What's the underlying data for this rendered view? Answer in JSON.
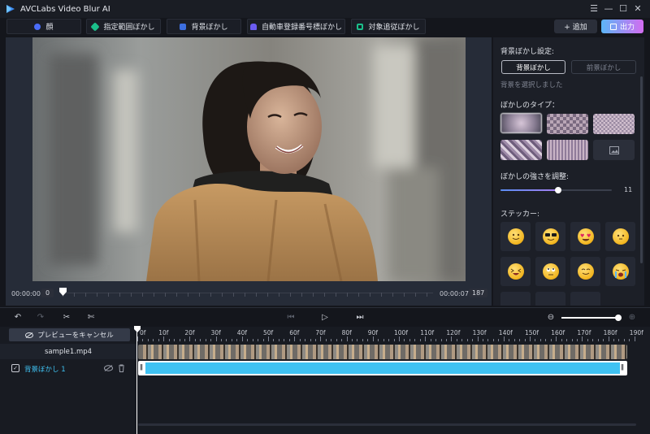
{
  "app": {
    "title": "AVCLabs Video Blur AI"
  },
  "toolbar": {
    "tools": [
      {
        "label": "顔",
        "color": "#4a6cf7"
      },
      {
        "label": "指定範囲ぼかし",
        "color": "#1bbf8a"
      },
      {
        "label": "背景ぼかし",
        "color": "#3d6fe0"
      },
      {
        "label": "自動車登録番号標ぼかし",
        "color": "#6b5cf2"
      },
      {
        "label": "対象追従ぼかし",
        "color": "#1bbf8a"
      }
    ],
    "add_label": "+ 追加",
    "export_label": "出力"
  },
  "preview": {
    "time_start": "00:00:00",
    "frame_start": "0",
    "time_end": "00:00:07",
    "frame_end": "187"
  },
  "panel": {
    "bg_setting_label": "背景ぼかし設定:",
    "bg_blur_button": "背景ぼかし",
    "fg_blur_button": "前景ぼかし",
    "hint": "背景を選択しました",
    "blur_type_label": "ぼかしのタイプ：",
    "strength_label": "ぼかしの強さを調整:",
    "strength_value": "11",
    "strength_fraction": 0.52,
    "sticker_label": "ステッカー:"
  },
  "timeline": {
    "cancel_preview_label": "プレビューをキャンセル",
    "file_name": "sample1.mp4",
    "track_label": "背景ぼかし 1",
    "ticks": [
      "0f",
      "10f",
      "20f",
      "30f",
      "40f",
      "50f",
      "60f",
      "70f",
      "80f",
      "90f",
      "100f",
      "110f",
      "120f",
      "130f",
      "140f",
      "150f",
      "160f",
      "170f",
      "180f",
      "190f"
    ],
    "zoom_fraction": 0.95
  },
  "colors": {
    "accent_blue": "#3fc2f2",
    "export_gradient_start": "#5bb5f6",
    "export_gradient_end": "#d36cf0"
  }
}
